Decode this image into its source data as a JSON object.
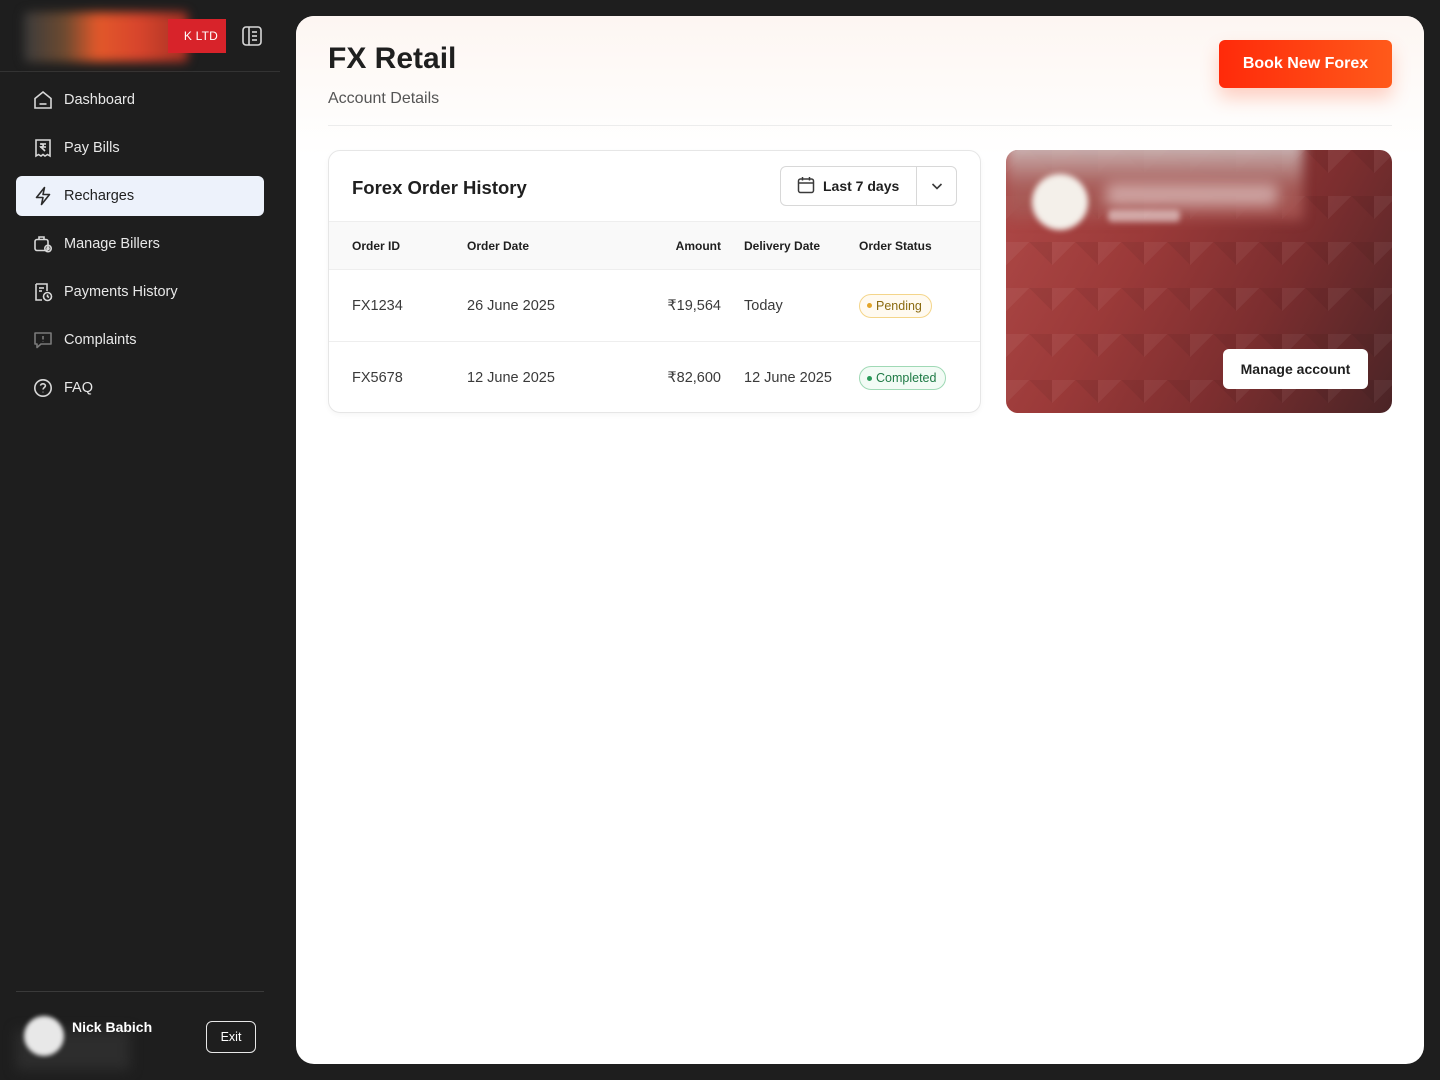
{
  "brand": {
    "tag_text": "K LTD",
    "icons": {
      "collapse": "sidebar-collapse-icon"
    }
  },
  "sidebar": {
    "items": [
      {
        "label": "Dashboard",
        "icon": "home-icon",
        "active": false
      },
      {
        "label": "Pay Bills",
        "icon": "rupee-receipt-icon",
        "active": false
      },
      {
        "label": "Recharges",
        "icon": "lightning-icon",
        "active": true
      },
      {
        "label": "Manage Billers",
        "icon": "briefcase-gear-icon",
        "active": false
      },
      {
        "label": "Payments History",
        "icon": "receipt-clock-icon",
        "active": false
      },
      {
        "label": "Complaints",
        "icon": "alert-message-icon",
        "active": false
      },
      {
        "label": "FAQ",
        "icon": "question-circle-icon",
        "active": false
      }
    ]
  },
  "user": {
    "name": "Nick Babich",
    "exit_label": "Exit"
  },
  "header": {
    "title": "FX Retail",
    "subtitle": "Account Details",
    "book_button": "Book New Forex"
  },
  "orders": {
    "title": "Forex Order History",
    "range_label": "Last 7 days",
    "columns": [
      "Order ID",
      "Order Date",
      "Amount",
      "Delivery Date",
      "Order Status"
    ],
    "rows": [
      {
        "id": "FX1234",
        "order_date": "26 June 2025",
        "amount": "₹19,564",
        "delivery_date": "Today",
        "status": "Pending"
      },
      {
        "id": "FX5678",
        "order_date": "12 June 2025",
        "amount": "₹82,600",
        "delivery_date": "12 June 2025",
        "status": "Completed"
      }
    ]
  },
  "account": {
    "manage_label": "Manage account"
  },
  "colors": {
    "accent": "#ff3d12",
    "sidebar_bg": "#1e1e1e",
    "active_item_bg": "#edf2fb",
    "pending": "#e3a52a",
    "completed": "#2a9a5a"
  }
}
